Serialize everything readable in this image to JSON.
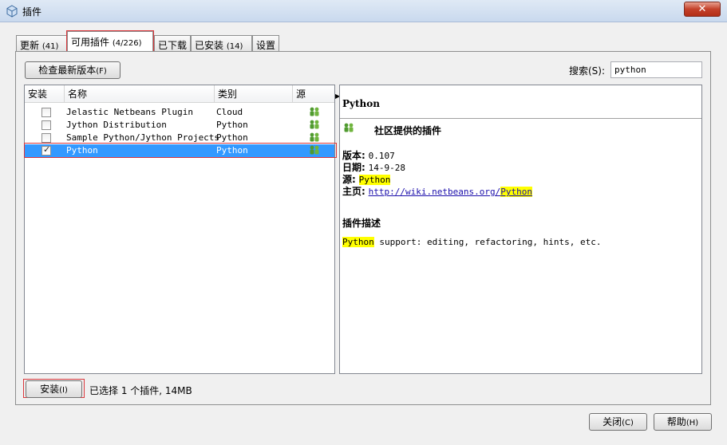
{
  "window": {
    "title": "插件",
    "close_label": "✕"
  },
  "tabs": [
    {
      "label": "更新",
      "count": "(41)"
    },
    {
      "label": "可用插件",
      "count": "(4/226)"
    },
    {
      "label": "已下载",
      "count": ""
    },
    {
      "label": "已安装",
      "count": "(14)"
    },
    {
      "label": "设置",
      "count": ""
    }
  ],
  "toolbar": {
    "check_latest_label": "检查最新版本",
    "check_latest_accel": "(F)"
  },
  "search": {
    "label": "搜索(S):",
    "value": "python"
  },
  "table": {
    "columns": [
      "安装",
      "名称",
      "类别",
      "源"
    ],
    "rows": [
      {
        "checked": false,
        "name": "Jelastic Netbeans Plugin",
        "category": "Cloud",
        "source_icon": "community-icon"
      },
      {
        "checked": false,
        "name": "Jython Distribution",
        "category": "Python",
        "source_icon": "community-icon"
      },
      {
        "checked": false,
        "name": "Sample Python/Jython Projects",
        "category": "Python",
        "source_icon": "community-icon"
      },
      {
        "checked": true,
        "name": "Python",
        "category": "Python",
        "source_icon": "community-icon"
      }
    ]
  },
  "detail": {
    "title": "Python",
    "provider": "社区提供的插件",
    "version_label": "版本:",
    "version": "0.107",
    "date_label": "日期:",
    "date": "14-9-28",
    "source_label": "源:",
    "source": "Python",
    "homepage_label": "主页:",
    "homepage_prefix": "http://wiki.netbeans.org/",
    "homepage_highlight": "Python",
    "description_heading": "插件描述",
    "description_highlight": "Python",
    "description_rest": " support: editing, refactoring, hints, etc."
  },
  "footer": {
    "install_label": "安装",
    "install_accel": "(I)",
    "status": "已选择 1 个插件, 14MB",
    "close_label": "关闭",
    "close_accel": "(C)",
    "help_label": "帮助",
    "help_accel": "(H)"
  },
  "colors": {
    "selection": "#3399ff",
    "highlight": "#ffff00",
    "annotation_red": "#d9363b"
  }
}
